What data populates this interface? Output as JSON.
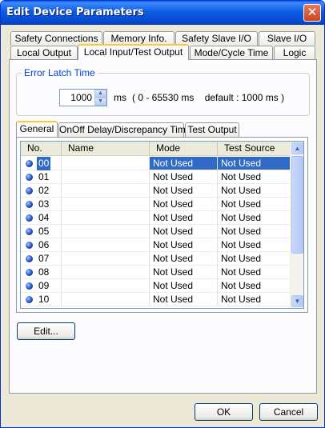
{
  "window": {
    "title": "Edit Device Parameters",
    "close_glyph": "✕"
  },
  "tabs_row1": [
    "Safety Connections",
    "Memory Info.",
    "Safety Slave I/O",
    "Slave I/O"
  ],
  "tabs_row2": [
    "Local Output",
    "Local Input/Test Output",
    "Mode/Cycle Time",
    "Logic"
  ],
  "active_tab": "Local Input/Test Output",
  "error_latch": {
    "label": "Error Latch Time",
    "value": "1000",
    "unit": "ms",
    "range_text": "( 0 - 65530 ms    default : 1000 ms )"
  },
  "subtabs": [
    "General",
    "OnOff Delay/Discrepancy Time",
    "Test Output"
  ],
  "active_subtab": "General",
  "table": {
    "columns": [
      "No.",
      "Name",
      "Mode",
      "Test Source"
    ],
    "rows": [
      {
        "no": "00",
        "name": "",
        "mode": "Not Used",
        "test_source": "Not Used"
      },
      {
        "no": "01",
        "name": "",
        "mode": "Not Used",
        "test_source": "Not Used"
      },
      {
        "no": "02",
        "name": "",
        "mode": "Not Used",
        "test_source": "Not Used"
      },
      {
        "no": "03",
        "name": "",
        "mode": "Not Used",
        "test_source": "Not Used"
      },
      {
        "no": "04",
        "name": "",
        "mode": "Not Used",
        "test_source": "Not Used"
      },
      {
        "no": "05",
        "name": "",
        "mode": "Not Used",
        "test_source": "Not Used"
      },
      {
        "no": "06",
        "name": "",
        "mode": "Not Used",
        "test_source": "Not Used"
      },
      {
        "no": "07",
        "name": "",
        "mode": "Not Used",
        "test_source": "Not Used"
      },
      {
        "no": "08",
        "name": "",
        "mode": "Not Used",
        "test_source": "Not Used"
      },
      {
        "no": "09",
        "name": "",
        "mode": "Not Used",
        "test_source": "Not Used"
      },
      {
        "no": "10",
        "name": "",
        "mode": "Not Used",
        "test_source": "Not Used"
      }
    ],
    "selected_row": "00"
  },
  "buttons": {
    "edit": "Edit...",
    "ok": "OK",
    "cancel": "Cancel"
  },
  "colors": {
    "title_bar": "#0b5ce4",
    "selection": "#316ac5",
    "active_tab_accent": "#ffc83c"
  }
}
